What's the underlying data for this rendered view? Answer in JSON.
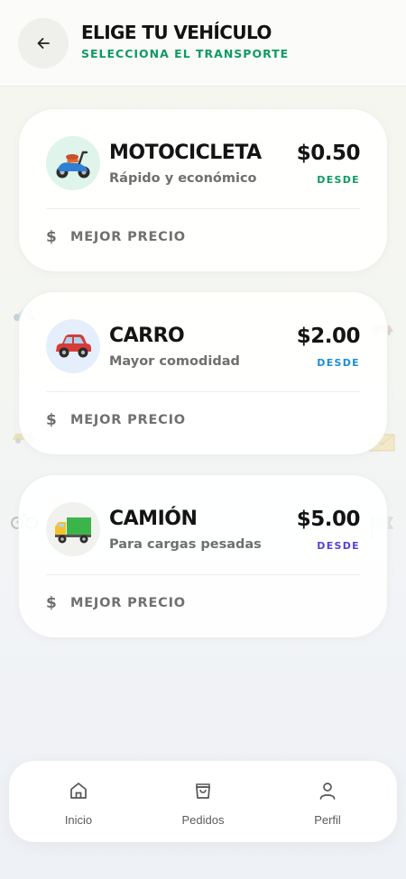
{
  "header": {
    "title": "ELIGE TU VEHÍCULO",
    "subtitle": "SELECCIONA EL TRANSPORTE",
    "back_icon": "arrow-left-icon"
  },
  "vehicles": [
    {
      "name": "MOTOCICLETA",
      "description": "Rápido y económico",
      "price": "$0.50",
      "price_from": "DESDE",
      "price_from_color": "#0f9a62",
      "icon_bg": "#dff4ea",
      "icon": "scooter-icon",
      "footer_icon": "dollar-icon",
      "footer_label": "MEJOR PRECIO"
    },
    {
      "name": "CARRO",
      "description": "Mayor comodidad",
      "price": "$2.00",
      "price_from": "DESDE",
      "price_from_color": "#1d8ed6",
      "icon_bg": "#e4effb",
      "icon": "car-icon",
      "footer_icon": "dollar-icon",
      "footer_label": "MEJOR PRECIO"
    },
    {
      "name": "CAMIÓN",
      "description": "Para cargas pesadas",
      "price": "$5.00",
      "price_from": "DESDE",
      "price_from_color": "#5a3fd6",
      "icon_bg": "#f1f1ee",
      "icon": "truck-icon",
      "footer_icon": "dollar-icon",
      "footer_label": "MEJOR PRECIO"
    }
  ],
  "bottom_nav": {
    "items": [
      {
        "label": "Inicio",
        "icon": "home-icon"
      },
      {
        "label": "Pedidos",
        "icon": "shopping-bag-icon"
      },
      {
        "label": "Perfil",
        "icon": "user-icon"
      }
    ]
  },
  "colors": {
    "accent_green": "#0f9a62",
    "accent_blue": "#1d8ed6",
    "accent_purple": "#5a3fd6"
  }
}
